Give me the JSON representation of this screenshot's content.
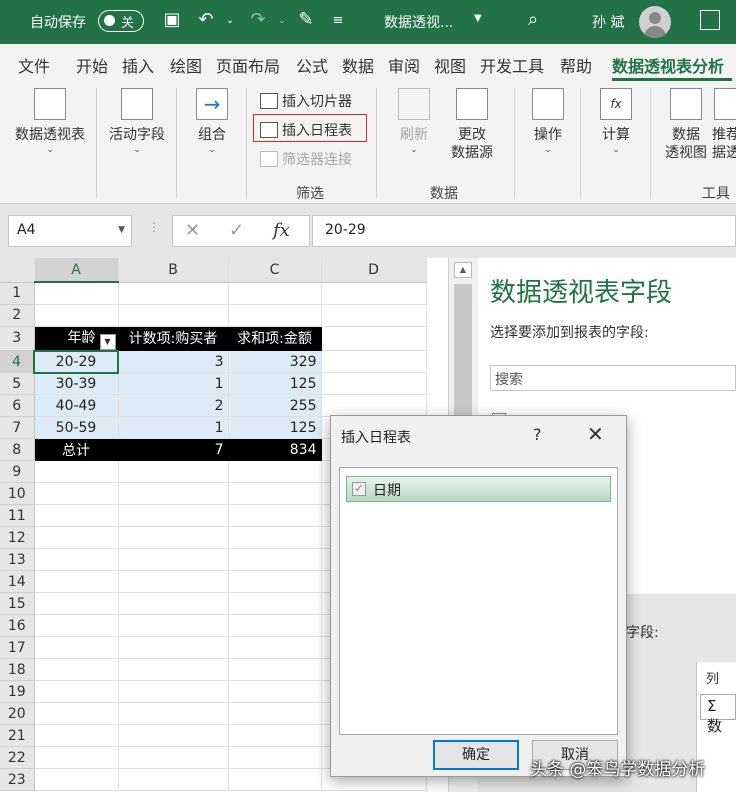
{
  "titlebar": {
    "autosave_label": "自动保存",
    "autosave_state": "关",
    "document_title": "数据透视...",
    "user_name": "孙 斌"
  },
  "tabs": [
    "文件",
    "开始",
    "插入",
    "绘图",
    "页面布局",
    "公式",
    "数据",
    "审阅",
    "视图",
    "开发工具",
    "帮助",
    "数据透视表分析"
  ],
  "active_tab": "数据透视表分析",
  "ribbon": {
    "pivottable": "数据透视表",
    "active_field": "活动字段",
    "group": "组合",
    "insert_slicer": "插入切片器",
    "insert_timeline": "插入日程表",
    "filter_connections": "筛选器连接",
    "filter_group": "筛选",
    "refresh": "刷新",
    "change_source_1": "更改",
    "change_source_2": "数据源",
    "data_group": "数据",
    "actions": "操作",
    "calculations": "计算",
    "pivotchart_1": "数据",
    "pivotchart_2": "透视图",
    "recommend_1": "推荐",
    "recommend_2": "据透",
    "tools_group": "工具"
  },
  "formula_bar": {
    "name_box": "A4",
    "fx": "fx",
    "formula": "20-29"
  },
  "grid": {
    "columns": [
      "A",
      "B",
      "C",
      "D"
    ],
    "rows": [
      "1",
      "2",
      "3",
      "4",
      "5",
      "6",
      "7",
      "8",
      "9",
      "10",
      "11",
      "12",
      "13",
      "14",
      "15",
      "16",
      "17",
      "18",
      "19",
      "20",
      "21",
      "22",
      "23"
    ],
    "header": {
      "age": "年龄",
      "count": "计数项:购买者",
      "sum": "求和项:金额"
    },
    "data": [
      {
        "age": "20-29",
        "count": "3",
        "sum": "329"
      },
      {
        "age": "30-39",
        "count": "1",
        "sum": "125"
      },
      {
        "age": "40-49",
        "count": "2",
        "sum": "255"
      },
      {
        "age": "50-59",
        "count": "1",
        "sum": "125"
      }
    ],
    "total": {
      "label": "总计",
      "count": "7",
      "sum": "834"
    }
  },
  "field_pane": {
    "title": "数据透视表字段",
    "subtitle": "选择要添加到报表的字段:",
    "search_placeholder": "搜索",
    "drag_label": "字段:",
    "columns_label": "列",
    "values_sigma": "Σ 数"
  },
  "dialog": {
    "title": "插入日程表",
    "help": "?",
    "close": "✕",
    "item": "日期",
    "ok": "确定",
    "cancel": "取消"
  },
  "watermark": "头条 @笨鸟学数据分析",
  "colors": {
    "accent": "#217346",
    "highlight_border": "#d62828",
    "pivot_fill": "#ddebf7"
  }
}
